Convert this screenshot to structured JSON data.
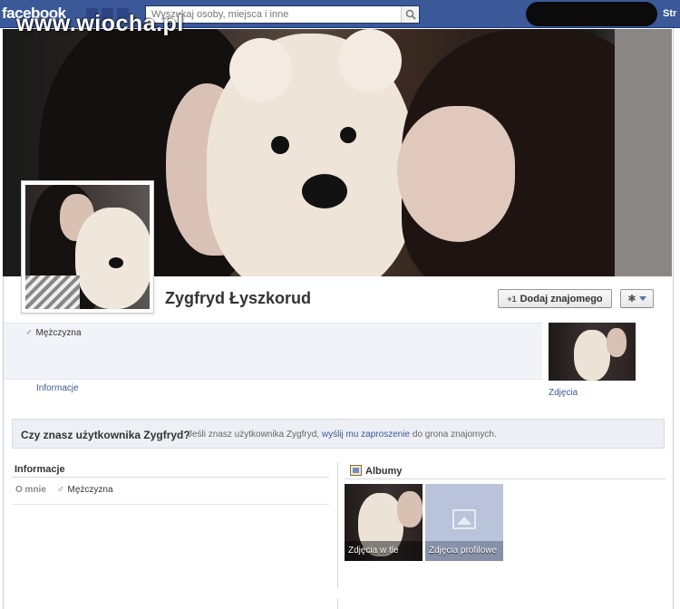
{
  "watermark": "www.wiocha.pl",
  "topbar": {
    "logo": "facebook",
    "search_placeholder": "Wyszukaj osoby, miejsca i inne",
    "right_link": "Str"
  },
  "profile": {
    "name": "Zygfryd Łyszkorud",
    "add_friend_label": "Dodaj znajomego",
    "gender": "Mężczyzna",
    "tabs": {
      "info": "Informacje",
      "photos": "Zdjęcia"
    }
  },
  "know_banner": {
    "question": "Czy znasz użytkownika Zygfryd?",
    "text_before": "Jeśli znasz użytkownika Zygfryd,",
    "link": "wyślij mu zaproszenie",
    "text_after": "do grona znajomych."
  },
  "info_section": {
    "title": "Informacje",
    "about_label": "O mnie",
    "about_value": "Mężczyzna"
  },
  "albums_section": {
    "title": "Albumy",
    "albums": [
      {
        "label": "Zdjęcia w tle"
      },
      {
        "label": "Zdjęcia profilowe"
      }
    ]
  },
  "colors": {
    "topbar": "#3b5998",
    "link": "#3b5998",
    "banner_bg": "#edeff4"
  }
}
